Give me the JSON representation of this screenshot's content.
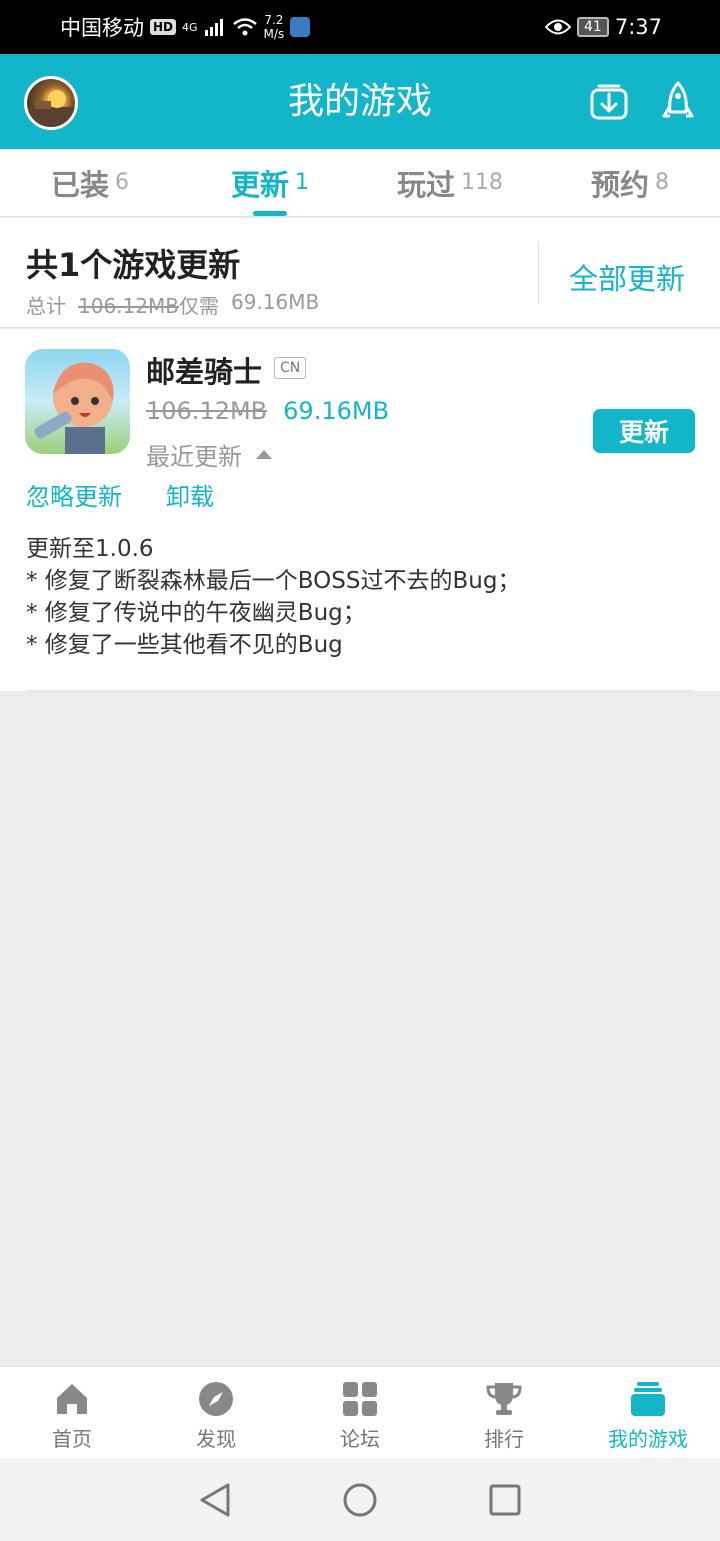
{
  "status_bar": {
    "carrier": "中国移动",
    "hd": "HD",
    "network": "4G",
    "speed_value": "7.2",
    "speed_unit": "M/s",
    "battery": "41",
    "time": "7:37"
  },
  "header": {
    "title": "我的游戏",
    "accent_color": "#13b5c8"
  },
  "tabs": [
    {
      "label": "已装",
      "count": "6"
    },
    {
      "label": "更新",
      "count": "1",
      "active": true
    },
    {
      "label": "玩过",
      "count": "118"
    },
    {
      "label": "预约",
      "count": "8"
    }
  ],
  "summary": {
    "title": "共1个游戏更新",
    "total_label": "总计",
    "total_size": "106.12MB",
    "only_need": "仅需",
    "need_size": "69.16MB",
    "update_all": "全部更新"
  },
  "game": {
    "name": "邮差骑士",
    "tag": "CN",
    "old_size": "106.12MB",
    "new_size": "69.16MB",
    "recent_label": "最近更新",
    "update_button": "更新",
    "ignore_label": "忽略更新",
    "uninstall_label": "卸载",
    "changelog": [
      "更新至1.0.6",
      "* 修复了断裂森林最后一个BOSS过不去的Bug；",
      "* 修复了传说中的午夜幽灵Bug；",
      "* 修复了一些其他看不见的Bug"
    ]
  },
  "bottom_nav": [
    {
      "label": "首页",
      "icon": "home-icon"
    },
    {
      "label": "发现",
      "icon": "compass-icon"
    },
    {
      "label": "论坛",
      "icon": "grid-icon"
    },
    {
      "label": "排行",
      "icon": "trophy-icon"
    },
    {
      "label": "我的游戏",
      "icon": "stack-icon",
      "active": true
    }
  ]
}
